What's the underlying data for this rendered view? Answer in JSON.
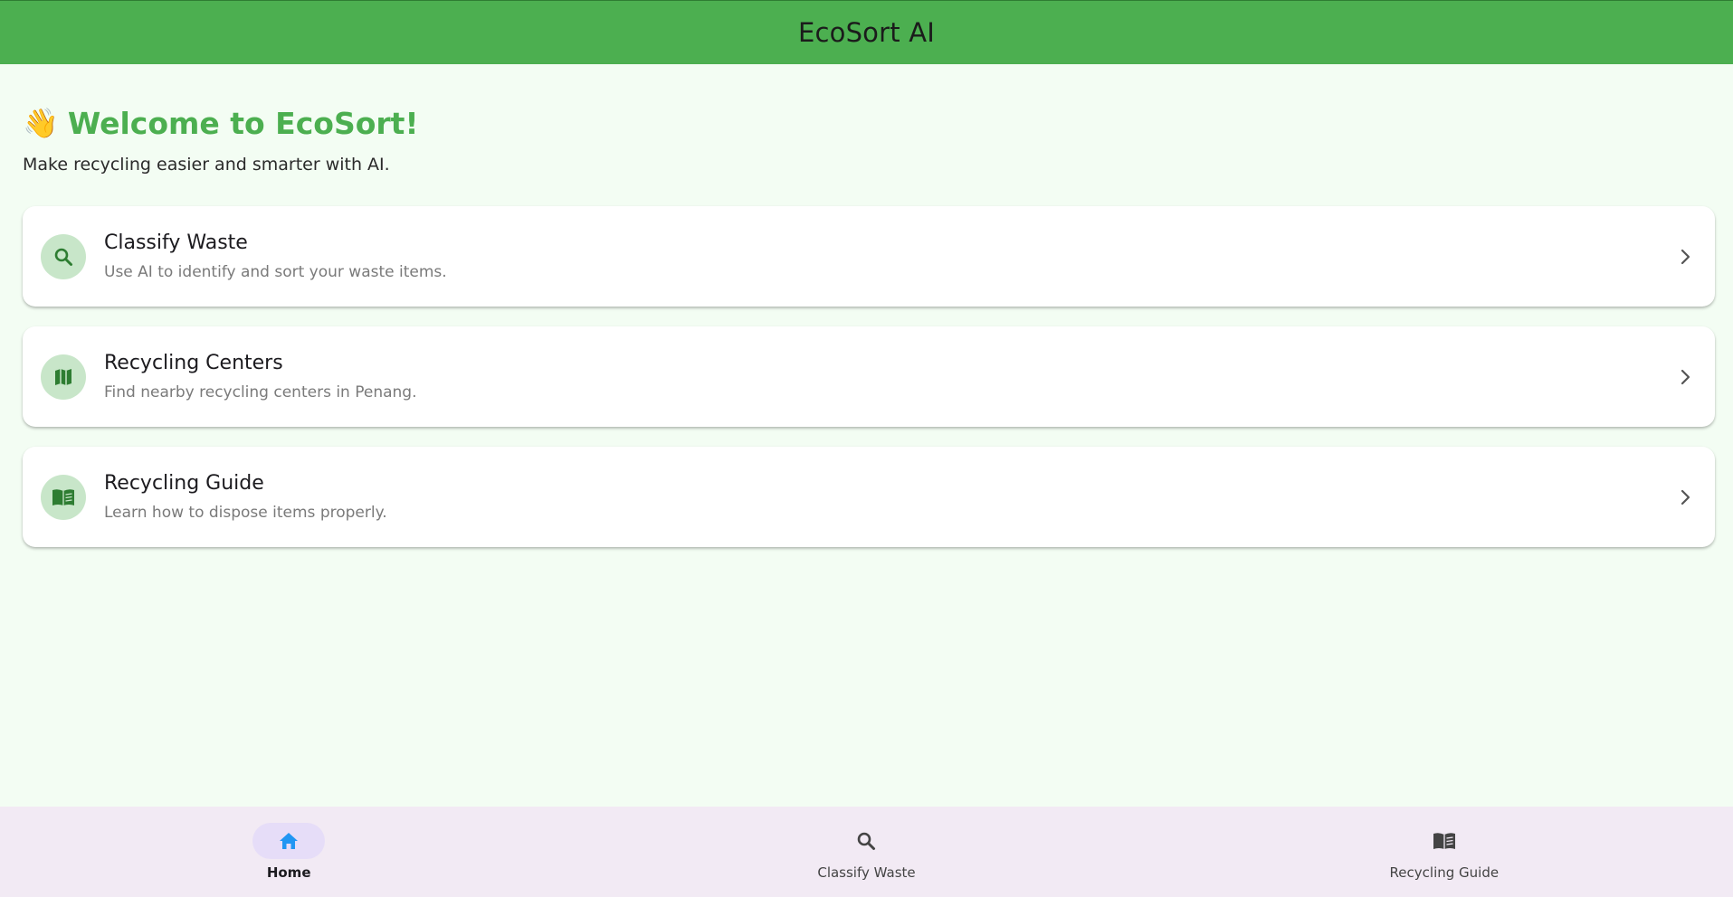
{
  "app_bar": {
    "title": "EcoSort AI"
  },
  "welcome": {
    "emoji": "👋",
    "title": "Welcome to EcoSort!",
    "subtitle": "Make recycling easier and smarter with AI."
  },
  "cards": [
    {
      "icon": "search-icon",
      "title": "Classify Waste",
      "subtitle": "Use AI to identify and sort your waste items."
    },
    {
      "icon": "map-icon",
      "title": "Recycling Centers",
      "subtitle": "Find nearby recycling centers in Penang."
    },
    {
      "icon": "book-icon",
      "title": "Recycling Guide",
      "subtitle": "Learn how to dispose items properly."
    }
  ],
  "bottom_nav": {
    "items": [
      {
        "icon": "home-icon",
        "label": "Home",
        "active": true
      },
      {
        "icon": "search-icon",
        "label": "Classify Waste",
        "active": false
      },
      {
        "icon": "book-icon",
        "label": "Recycling Guide",
        "active": false
      }
    ]
  },
  "colors": {
    "primary": "#4CAF50",
    "primary_dark": "#2E7D32",
    "icon_circle": "#C8E6C9",
    "background": "#F3FDF3",
    "nav_background": "#F2EAF4",
    "nav_indicator": "#E6DDF8",
    "home_icon": "#2196F3"
  }
}
